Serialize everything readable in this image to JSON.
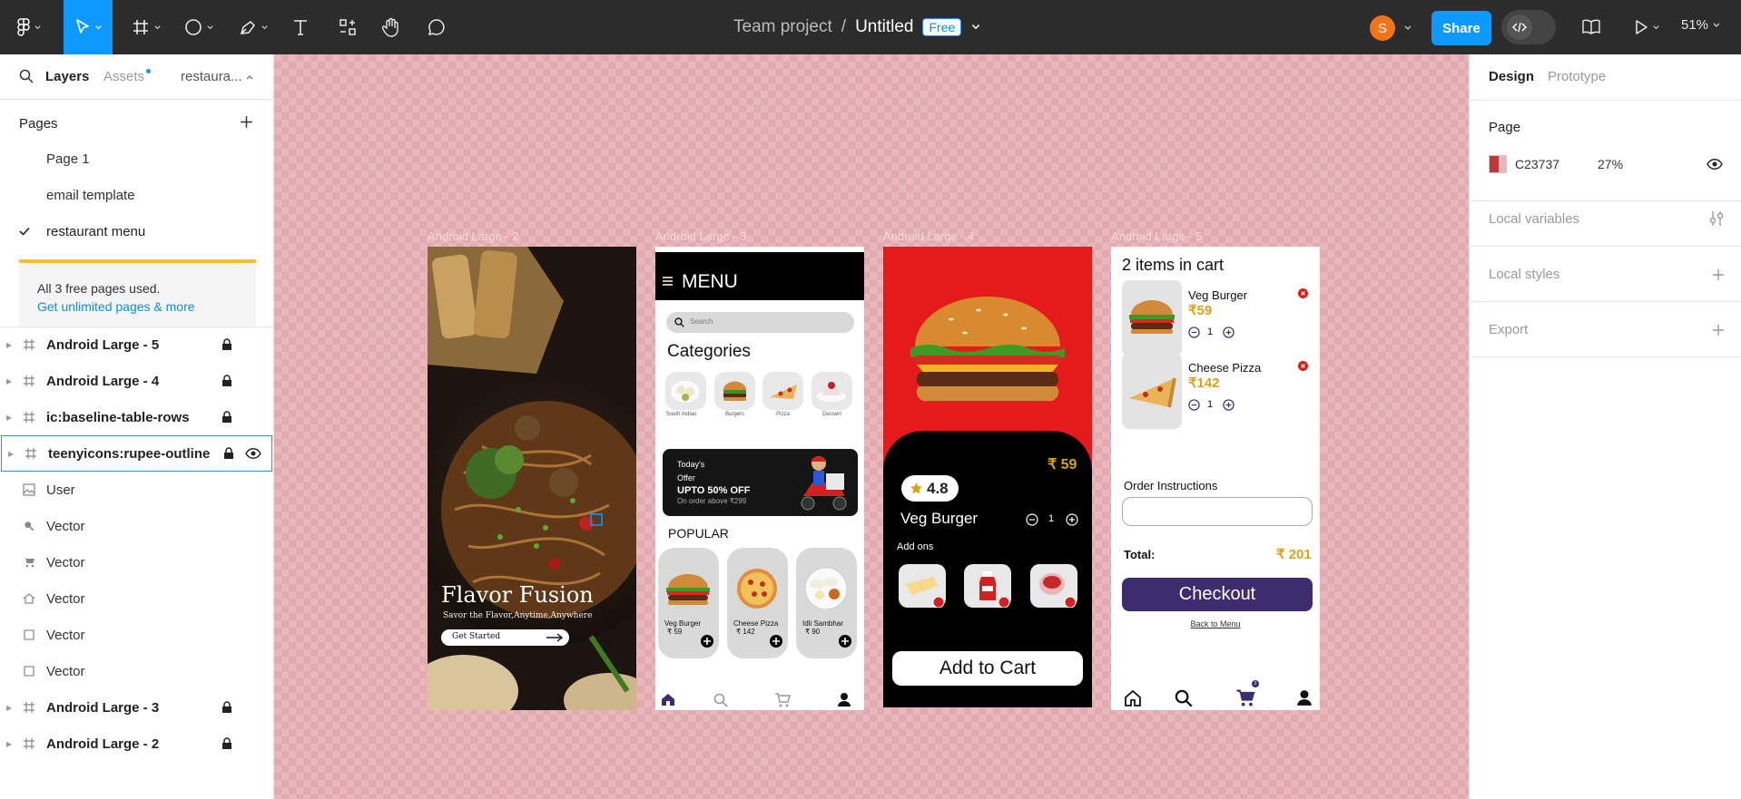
{
  "toolbar": {
    "project": "Team project",
    "separator": "/",
    "file": "Untitled",
    "badge": "Free",
    "share": "Share",
    "avatar_initial": "S",
    "avatar_color": "#f47318",
    "zoom": "51%"
  },
  "left_panel": {
    "tabs": {
      "layers": "Layers",
      "assets": "Assets",
      "page": "restaura..."
    },
    "pages_title": "Pages",
    "pages": [
      "Page 1",
      "email template",
      "restaurant menu"
    ],
    "current_page_index": 2,
    "notice": {
      "text": "All 3 free pages used.",
      "link": "Get unlimited pages & more"
    },
    "layers": [
      {
        "name": "Android Large - 5",
        "icon": "frame-icon",
        "locked": true,
        "bold": true
      },
      {
        "name": "Android Large - 4",
        "icon": "frame-icon",
        "locked": true,
        "bold": true
      },
      {
        "name": "ic:baseline-table-rows",
        "icon": "frame-icon",
        "locked": true,
        "bold": true
      },
      {
        "name": "teenyicons:rupee-outline",
        "icon": "frame-icon",
        "locked": true,
        "bold": true,
        "selected": true
      },
      {
        "name": "User",
        "icon": "image-icon",
        "locked": false,
        "bold": false
      },
      {
        "name": "Vector",
        "icon": "search-icon",
        "locked": false,
        "bold": false
      },
      {
        "name": "Vector",
        "icon": "cart-icon",
        "locked": false,
        "bold": false
      },
      {
        "name": "Vector",
        "icon": "home-icon",
        "locked": false,
        "bold": false
      },
      {
        "name": "Vector",
        "icon": "square-icon",
        "locked": false,
        "bold": false
      },
      {
        "name": "Vector",
        "icon": "square-icon",
        "locked": false,
        "bold": false
      },
      {
        "name": "Android Large - 3",
        "icon": "frame-icon",
        "locked": true,
        "bold": true
      },
      {
        "name": "Android Large - 2",
        "icon": "frame-icon",
        "locked": true,
        "bold": true
      }
    ]
  },
  "canvas": {
    "background": "#e8b8bc",
    "frames": {
      "f2": {
        "label": "Android Large - 2",
        "title": "Flavor Fusion",
        "tagline": "Savor the Flavor,Anytime,Anywhere",
        "cta": "Get Started"
      },
      "f3": {
        "label": "Android Large - 3",
        "menu": "MENU",
        "search_placeholder": "Search",
        "categories_title": "Categories",
        "categories": [
          "South Indian",
          "Burgers",
          "Pizza",
          "Dessert"
        ],
        "offer": {
          "l1": "Today's",
          "l2": "Offer",
          "l3": "UPTO 50% OFF",
          "l4": "On order above ₹299"
        },
        "popular_title": "POPULAR",
        "popular": [
          {
            "name": "Veg Burger",
            "price": "₹ 59"
          },
          {
            "name": "Cheese Pizza",
            "price": "₹ 142"
          },
          {
            "name": "Idli Sambhar",
            "price": "₹ 90"
          }
        ]
      },
      "f4": {
        "label": "Android Large - 4",
        "price": "₹ 59",
        "rating": "4.8",
        "name": "Veg Burger",
        "qty": "1",
        "addons_title": "Add ons",
        "button": "Add to Cart",
        "accent": "#e51b1b"
      },
      "f5": {
        "label": "Android Large - 5",
        "title": "2 items in cart",
        "items": [
          {
            "name": "Veg Burger",
            "price": "₹59",
            "qty": "1"
          },
          {
            "name": "Cheese Pizza",
            "price": "₹142",
            "qty": "1"
          }
        ],
        "instructions": "Order Instructions",
        "total_label": "Total:",
        "total_value": "₹ 201",
        "checkout": "Checkout",
        "back": "Back to Menu",
        "cart_badge": "2",
        "accent": "#3d2c6e",
        "price_color": "#d9a21b"
      }
    }
  },
  "right_panel": {
    "tabs": {
      "design": "Design",
      "prototype": "Prototype"
    },
    "page_section": "Page",
    "fill_hex": "C23737",
    "fill_opacity": "27%",
    "fill_color": "#c23737",
    "sections": [
      "Local variables",
      "Local styles",
      "Export"
    ]
  }
}
